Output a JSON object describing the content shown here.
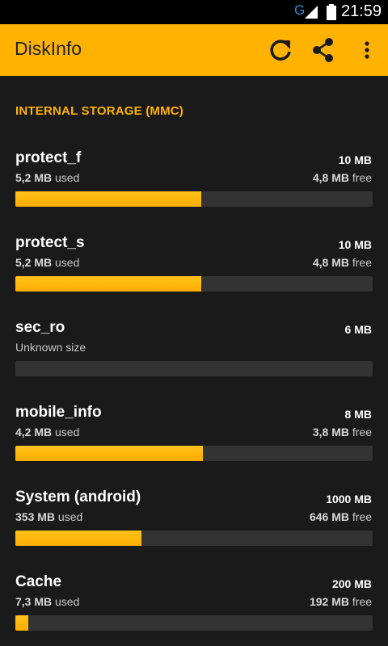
{
  "status_bar": {
    "network": "G",
    "time": "21:59",
    "icons": [
      "signal-icon",
      "battery-icon"
    ]
  },
  "app_bar": {
    "title": "DiskInfo",
    "actions": [
      "refresh-icon",
      "share-icon",
      "more-vert-icon"
    ]
  },
  "colors": {
    "accent": "#ffb300",
    "background": "#1a1a1a",
    "bar_track": "#333333"
  },
  "section": {
    "title": "INTERNAL STORAGE (MMC)"
  },
  "partitions": [
    {
      "name": "protect_f",
      "total": "10 MB",
      "used_value": "5,2 MB",
      "used_suffix": " used",
      "free_value": "4,8 MB",
      "free_suffix": " free",
      "used_fraction": 0.52
    },
    {
      "name": "protect_s",
      "total": "10 MB",
      "used_value": "5,2 MB",
      "used_suffix": " used",
      "free_value": "4,8 MB",
      "free_suffix": " free",
      "used_fraction": 0.52
    },
    {
      "name": "sec_ro",
      "total": "6 MB",
      "used_value": "Unknown size",
      "used_suffix": "",
      "free_value": "",
      "free_suffix": "",
      "used_fraction": 0
    },
    {
      "name": "mobile_info",
      "total": "8 MB",
      "used_value": "4,2 MB",
      "used_suffix": " used",
      "free_value": "3,8 MB",
      "free_suffix": " free",
      "used_fraction": 0.525
    },
    {
      "name": "System (android)",
      "total": "1000 MB",
      "used_value": "353 MB",
      "used_suffix": " used",
      "free_value": "646 MB",
      "free_suffix": " free",
      "used_fraction": 0.353
    },
    {
      "name": "Cache",
      "total": "200 MB",
      "used_value": "7,3 MB",
      "used_suffix": " used",
      "free_value": "192 MB",
      "free_suffix": " free",
      "used_fraction": 0.0365
    }
  ]
}
